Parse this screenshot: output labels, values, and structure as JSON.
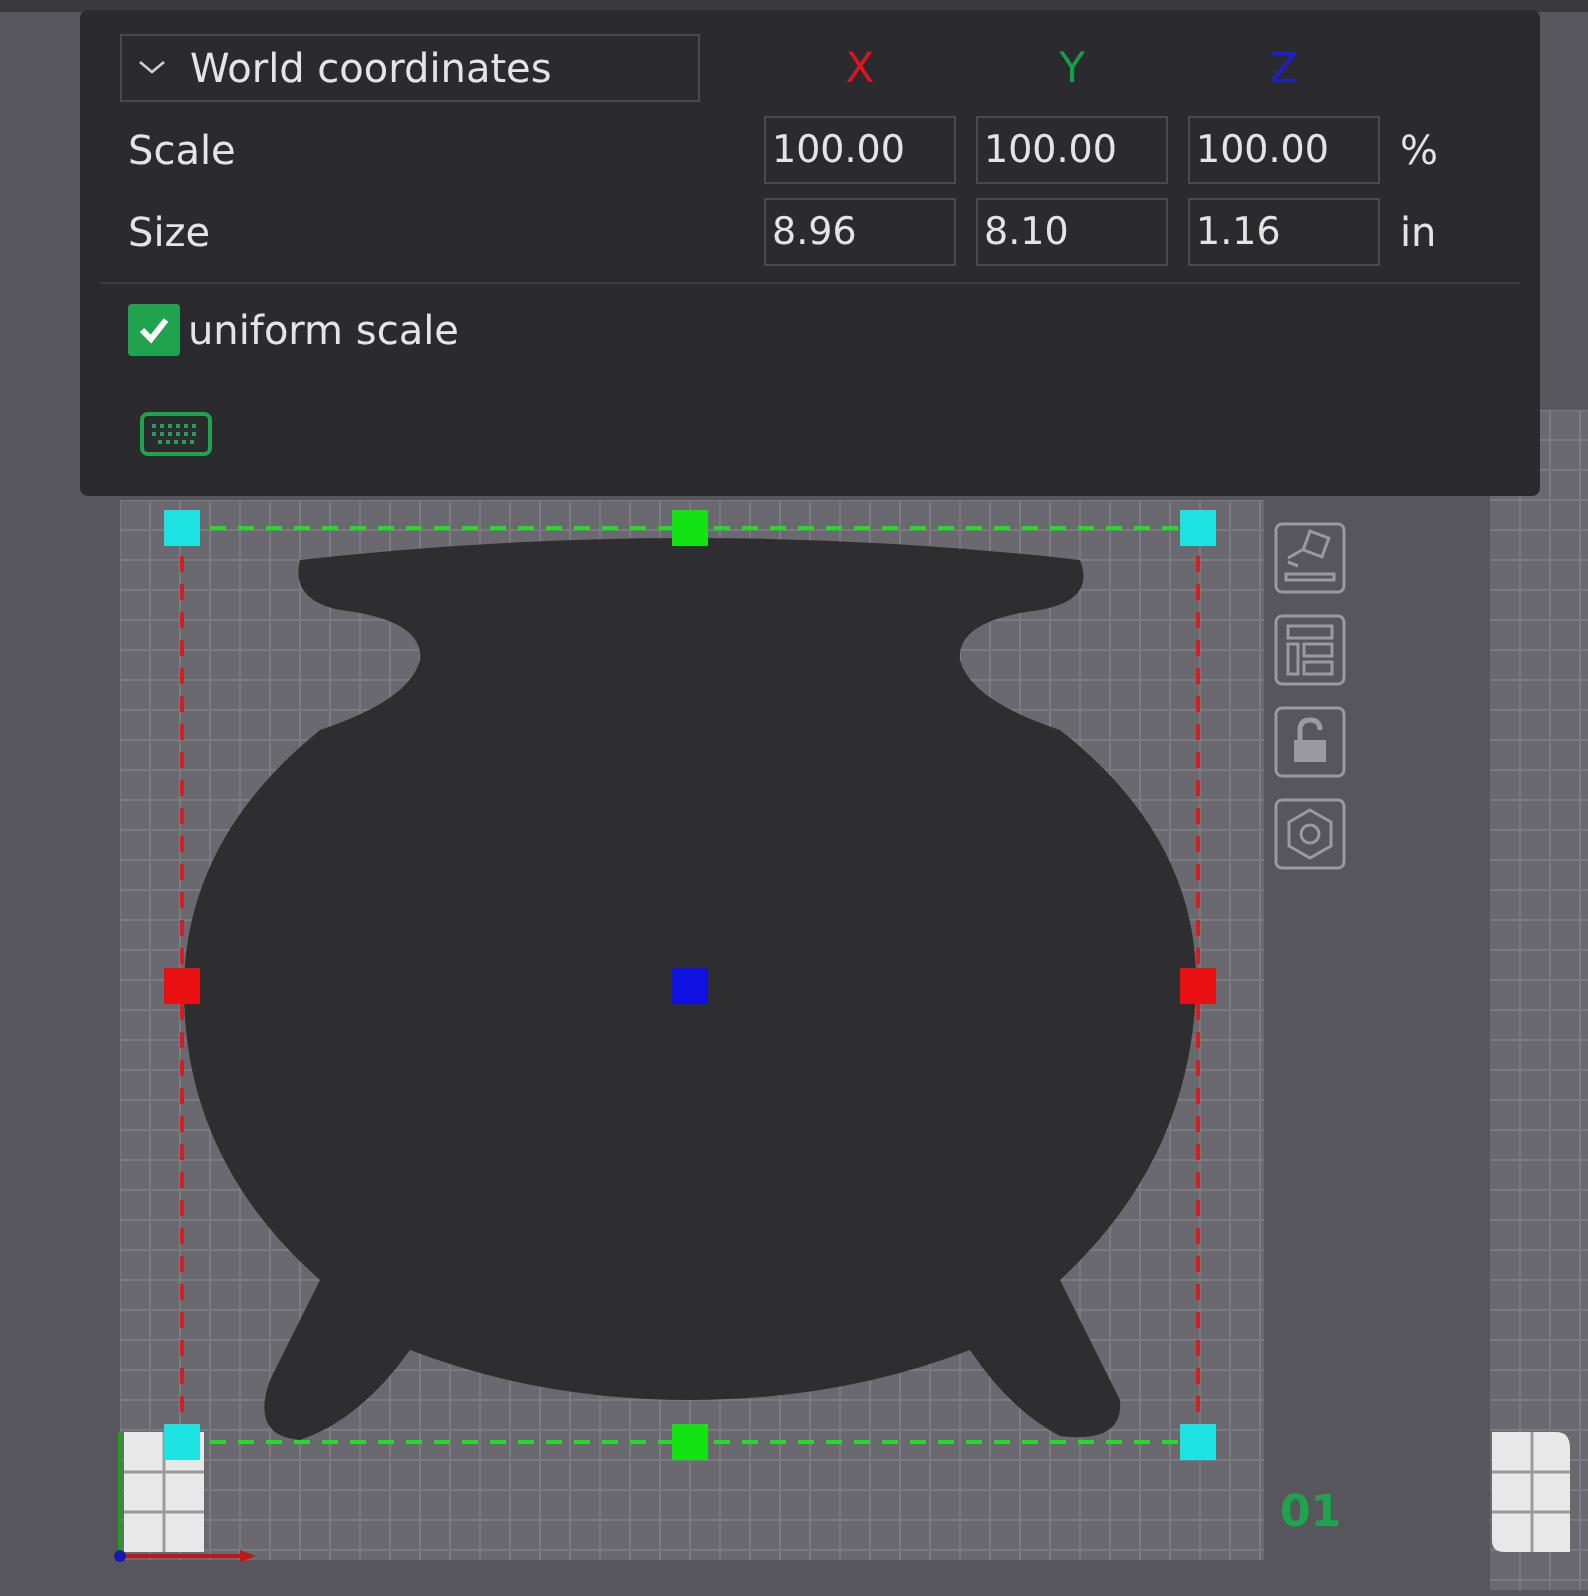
{
  "scale_panel": {
    "coordinate_mode": "World coordinates",
    "axes": [
      {
        "label": "X",
        "color": "#d8161b"
      },
      {
        "label": "Y",
        "color": "#14a04a"
      },
      {
        "label": "Z",
        "color": "#2020c8"
      }
    ],
    "rows": [
      {
        "label": "Scale",
        "values": [
          "100.00",
          "100.00",
          "100.00"
        ],
        "unit": "%"
      },
      {
        "label": "Size",
        "values": [
          "8.96",
          "8.10",
          "1.16"
        ],
        "unit": "in"
      }
    ],
    "uniform_scale": {
      "label": "uniform scale",
      "checked": true
    }
  },
  "plate": {
    "number": "01"
  }
}
